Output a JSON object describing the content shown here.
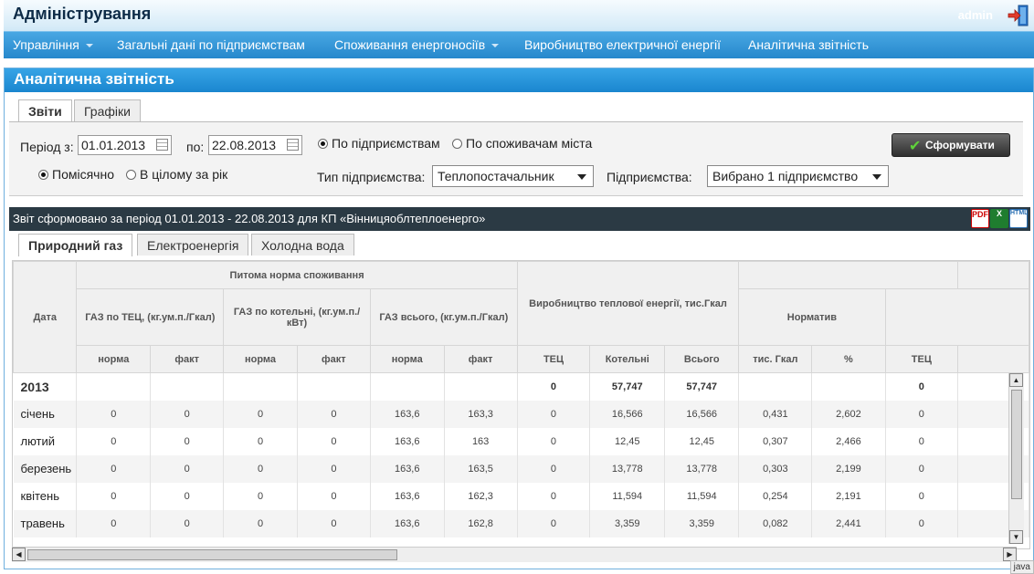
{
  "header": {
    "title": "Адміністрування",
    "user": "admin"
  },
  "nav": [
    {
      "label": "Управління",
      "has_caret": true
    },
    {
      "label": "Загальні дані по підприємствам",
      "has_caret": false
    },
    {
      "label": "Споживання енергоносіїв",
      "has_caret": true
    },
    {
      "label": "Виробництво електричної енергії",
      "has_caret": false
    },
    {
      "label": "Аналітична звітність",
      "has_caret": false
    }
  ],
  "panel": {
    "title": "Аналітична звітність"
  },
  "tabs": [
    "Звіти",
    "Графіки"
  ],
  "filters": {
    "period_label": "Період з:",
    "date_from": "01.01.2013",
    "to_label": "по:",
    "date_to": "22.08.2013",
    "radio_by_enterprise": "По підприємствам",
    "radio_by_consumers": "По споживачам міста",
    "radio_monthly": "Помісячно",
    "radio_yearly": "В цілому за рік",
    "type_label": "Тип підприємства:",
    "type_value": "Теплопостачальник",
    "enterprise_label": "Підприємства:",
    "enterprise_value": "Вибрано 1 підприємство",
    "submit": "Сформувати"
  },
  "report": {
    "caption": "Звіт сформовано за період 01.01.2013 - 22.08.2013 для КП «Вінницяоблтеплоенерго»",
    "export": {
      "pdf": "PDF",
      "xls": "X",
      "html": "HTML"
    }
  },
  "subtabs": [
    "Природний газ",
    "Електроенергія",
    "Холодна вода"
  ],
  "table": {
    "h_date": "Дата",
    "h_group1": "Питома норма споживання",
    "h_gas_tec": "ГАЗ по ТЕЦ, (кг.ум.п./Гкал)",
    "h_gas_boiler": "ГАЗ по котельні, (кг.ум.п./кВт)",
    "h_gas_total": "ГАЗ всього, (кг.ум.п./Гкал)",
    "h_production": "Виробництво теплової енергії, тис.Гкал",
    "h_normative": "Норматив",
    "sub": [
      "норма",
      "факт",
      "норма",
      "факт",
      "норма",
      "факт",
      "ТЕЦ",
      "Котельні",
      "Всього",
      "тис. Гкал",
      "%",
      "ТЕЦ"
    ],
    "rows": [
      {
        "date": "2013",
        "year": true,
        "v": [
          "",
          "",
          "",
          "",
          "",
          "",
          "0",
          "57,747",
          "57,747",
          "",
          "",
          "0"
        ]
      },
      {
        "date": "січень",
        "v": [
          "0",
          "0",
          "0",
          "0",
          "163,6",
          "163,3",
          "0",
          "16,566",
          "16,566",
          "0,431",
          "2,602",
          "0"
        ]
      },
      {
        "date": "лютий",
        "v": [
          "0",
          "0",
          "0",
          "0",
          "163,6",
          "163",
          "0",
          "12,45",
          "12,45",
          "0,307",
          "2,466",
          "0"
        ]
      },
      {
        "date": "березень",
        "v": [
          "0",
          "0",
          "0",
          "0",
          "163,6",
          "163,5",
          "0",
          "13,778",
          "13,778",
          "0,303",
          "2,199",
          "0"
        ]
      },
      {
        "date": "квітень",
        "v": [
          "0",
          "0",
          "0",
          "0",
          "163,6",
          "162,3",
          "0",
          "11,594",
          "11,594",
          "0,254",
          "2,191",
          "0"
        ]
      },
      {
        "date": "травень",
        "v": [
          "0",
          "0",
          "0",
          "0",
          "163,6",
          "162,8",
          "0",
          "3,359",
          "3,359",
          "0,082",
          "2,441",
          "0"
        ]
      }
    ]
  },
  "status": {
    "java": "java"
  }
}
